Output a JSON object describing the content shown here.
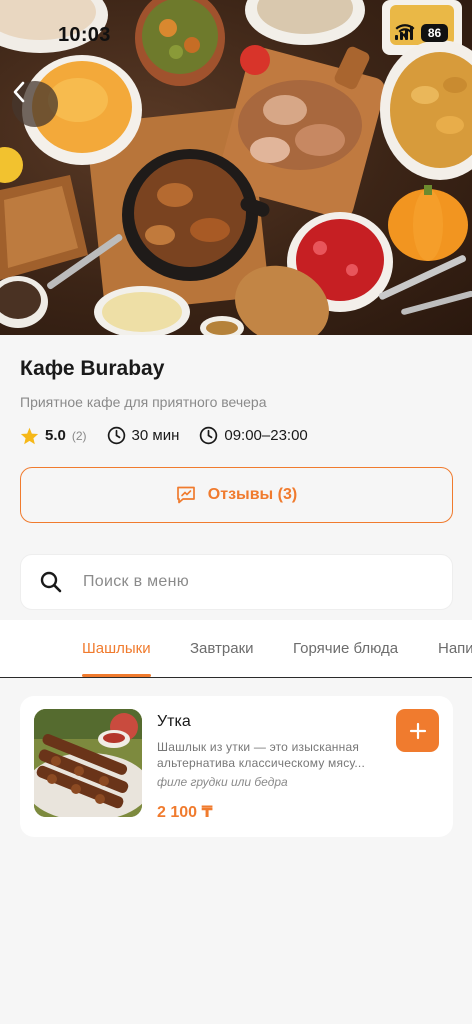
{
  "status_bar": {
    "time": "10:03",
    "battery": "86"
  },
  "cafe": {
    "title": "Кафе Burabay",
    "subtitle": "Приятное кафе для приятного вечера",
    "rating": "5.0",
    "rating_count": "(2)",
    "delivery_time": "30 мин",
    "hours": "09:00–23:00"
  },
  "reviews_button": {
    "label": "Отзывы (3)"
  },
  "search": {
    "placeholder": "Поиск в меню"
  },
  "tabs": [
    {
      "label": "Шашлыки",
      "active": true
    },
    {
      "label": "Завтраки",
      "active": false
    },
    {
      "label": "Горячие блюда",
      "active": false
    },
    {
      "label": "Напитки",
      "active": false
    }
  ],
  "menu_items": [
    {
      "name": "Утка",
      "description_line1": "Шашлык из утки — это изысканная",
      "description_line2": "альтернатива классическому мясу...",
      "note": "филе грудки или бедра",
      "price": "2 100 ₸"
    }
  ],
  "colors": {
    "accent": "#f07b2e",
    "background": "#f6f6f6",
    "card": "#ffffff"
  },
  "icons": [
    "back-arrow-icon",
    "star-icon",
    "clock-icon",
    "reviews-icon",
    "search-icon",
    "plus-icon",
    "wifi-icon",
    "signal-icon"
  ]
}
